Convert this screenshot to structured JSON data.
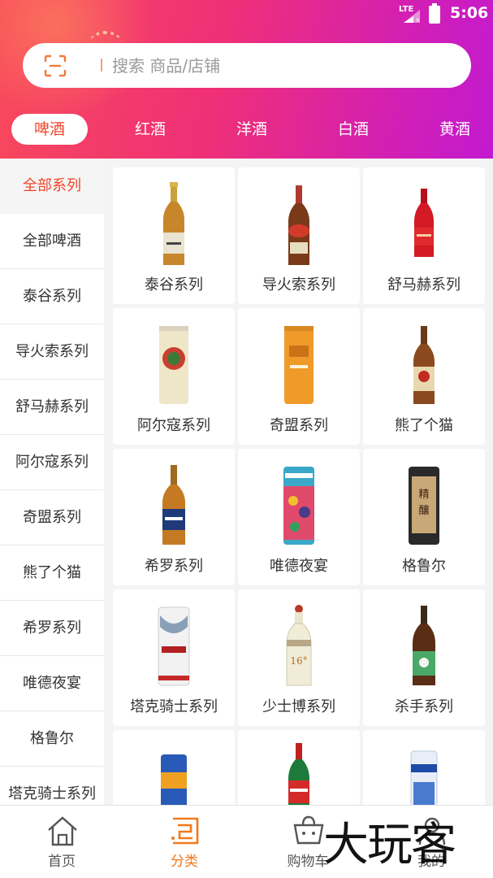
{
  "status": {
    "network": "LTE",
    "time": "5:06"
  },
  "search": {
    "placeholder": "搜索 商品/店铺"
  },
  "tabs": [
    {
      "label": "啤酒",
      "active": true
    },
    {
      "label": "红酒"
    },
    {
      "label": "洋酒"
    },
    {
      "label": "白酒"
    },
    {
      "label": "黄酒"
    }
  ],
  "sidebar": {
    "items": [
      {
        "label": "全部系列",
        "active": true
      },
      {
        "label": "全部啤酒"
      },
      {
        "label": "泰谷系列"
      },
      {
        "label": "导火索系列"
      },
      {
        "label": "舒马赫系列"
      },
      {
        "label": "阿尔寇系列"
      },
      {
        "label": "奇盟系列"
      },
      {
        "label": "熊了个猫"
      },
      {
        "label": "希罗系列"
      },
      {
        "label": "唯德夜宴"
      },
      {
        "label": "格鲁尔"
      },
      {
        "label": "塔克骑士系列"
      }
    ]
  },
  "products": [
    {
      "name": "泰谷系列",
      "icon": "amber-bottle-icon"
    },
    {
      "name": "导火索系列",
      "icon": "brown-bottle-icon"
    },
    {
      "name": "舒马赫系列",
      "icon": "red-bottle-icon"
    },
    {
      "name": "阿尔寇系列",
      "icon": "cream-can-icon"
    },
    {
      "name": "奇盟系列",
      "icon": "orange-can-icon"
    },
    {
      "name": "熊了个猫",
      "icon": "brown-bottle-icon"
    },
    {
      "name": "希罗系列",
      "icon": "amber-bottle-icon"
    },
    {
      "name": "唯德夜宴",
      "icon": "colorful-can-icon"
    },
    {
      "name": "格鲁尔",
      "icon": "dark-tin-can-icon"
    },
    {
      "name": "塔克骑士系列",
      "icon": "white-can-icon"
    },
    {
      "name": "少士博系列",
      "icon": "ceramic-bottle-icon"
    },
    {
      "name": "杀手系列",
      "icon": "dark-bottle-icon"
    },
    {
      "name": "",
      "icon": "blue-can-icon"
    },
    {
      "name": "",
      "icon": "green-bottle-icon"
    },
    {
      "name": "",
      "icon": "white-blue-can-icon"
    }
  ],
  "bottom_nav": [
    {
      "label": "首页",
      "icon": "home-icon"
    },
    {
      "label": "分类",
      "icon": "category-icon",
      "active": true
    },
    {
      "label": "购物车",
      "icon": "cart-icon"
    },
    {
      "label": "我的",
      "icon": "profile-icon"
    }
  ],
  "watermark": "大玩客",
  "colors": {
    "accent": "#f0452a",
    "nav_active": "#f07a1e",
    "header_start": "#f8495a",
    "header_end": "#c21ad0"
  }
}
